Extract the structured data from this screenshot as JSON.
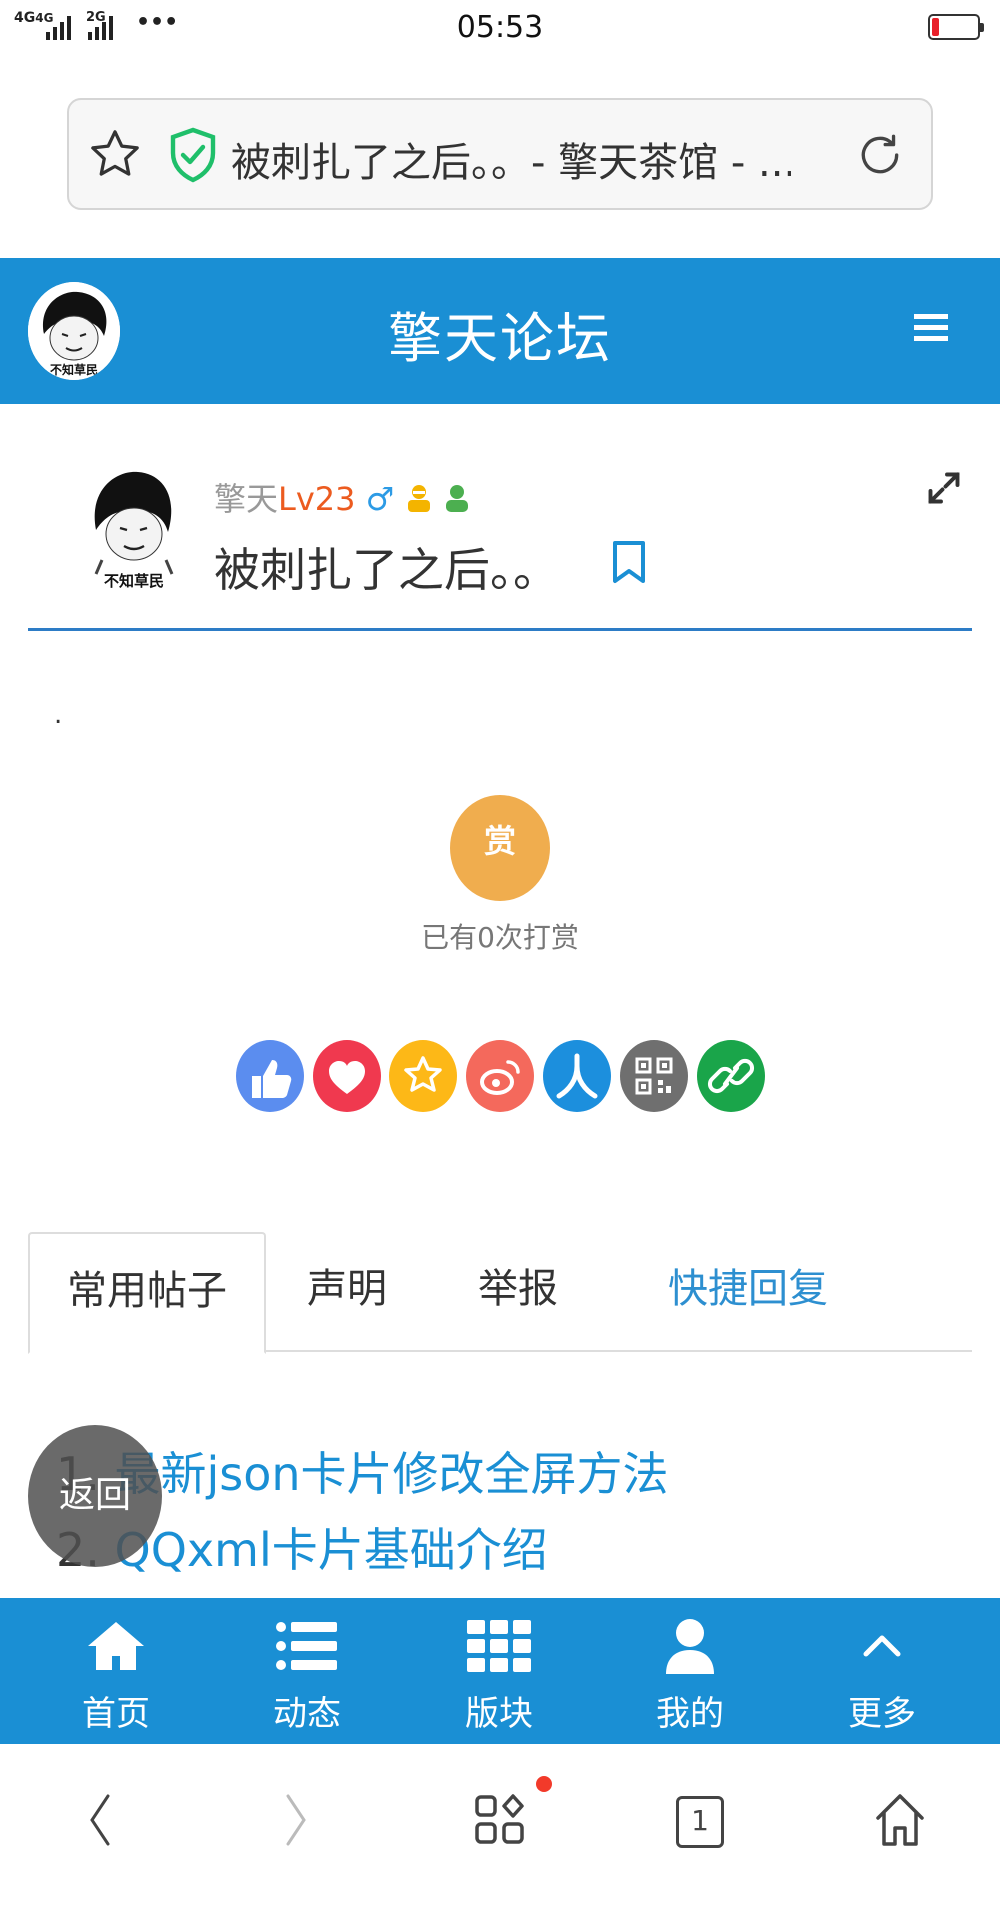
{
  "status_bar": {
    "network_1": "4G",
    "network_1b": "4G",
    "network_2": "2G",
    "more": "•••",
    "time": "05:53",
    "battery_level": 0.15
  },
  "browser": {
    "address_title": "被刺扎了之后。。- 擎天茶馆 - ...",
    "tab_count": "1"
  },
  "header": {
    "title": "擎天论坛"
  },
  "post": {
    "author_name": "擎天",
    "author_level": "Lv23",
    "gender_symbol": "♂",
    "title": "被刺扎了之后。。",
    "body": "."
  },
  "reward": {
    "button_label": "赏",
    "count_text": "已有0次打赏"
  },
  "share_icons": [
    {
      "name": "like-icon",
      "color": "#5b8def"
    },
    {
      "name": "favorite-heart-icon",
      "color": "#f0394f"
    },
    {
      "name": "qzone-star-icon",
      "color": "#fdb817"
    },
    {
      "name": "weibo-icon",
      "color": "#f4695c"
    },
    {
      "name": "renren-icon",
      "color": "#1c8fdd"
    },
    {
      "name": "qrcode-icon",
      "color": "#6f6f6f"
    },
    {
      "name": "copy-link-icon",
      "color": "#1aa54a"
    }
  ],
  "tabs": [
    {
      "label": "常用帖子",
      "active": true
    },
    {
      "label": "声明",
      "active": false
    },
    {
      "label": "举报",
      "active": false
    },
    {
      "label": "快捷回复",
      "active": false
    }
  ],
  "post_list": [
    {
      "num": "1.",
      "title": "最新json卡片修改全屏方法"
    },
    {
      "num": "2.",
      "title": "QQxml卡片基础介绍"
    }
  ],
  "back_button": "返回",
  "bottom_nav": [
    {
      "label": "首页",
      "icon": "home-icon"
    },
    {
      "label": "动态",
      "icon": "list-icon"
    },
    {
      "label": "版块",
      "icon": "grid-icon"
    },
    {
      "label": "我的",
      "icon": "user-icon"
    },
    {
      "label": "更多",
      "icon": "chevron-up-icon"
    }
  ]
}
